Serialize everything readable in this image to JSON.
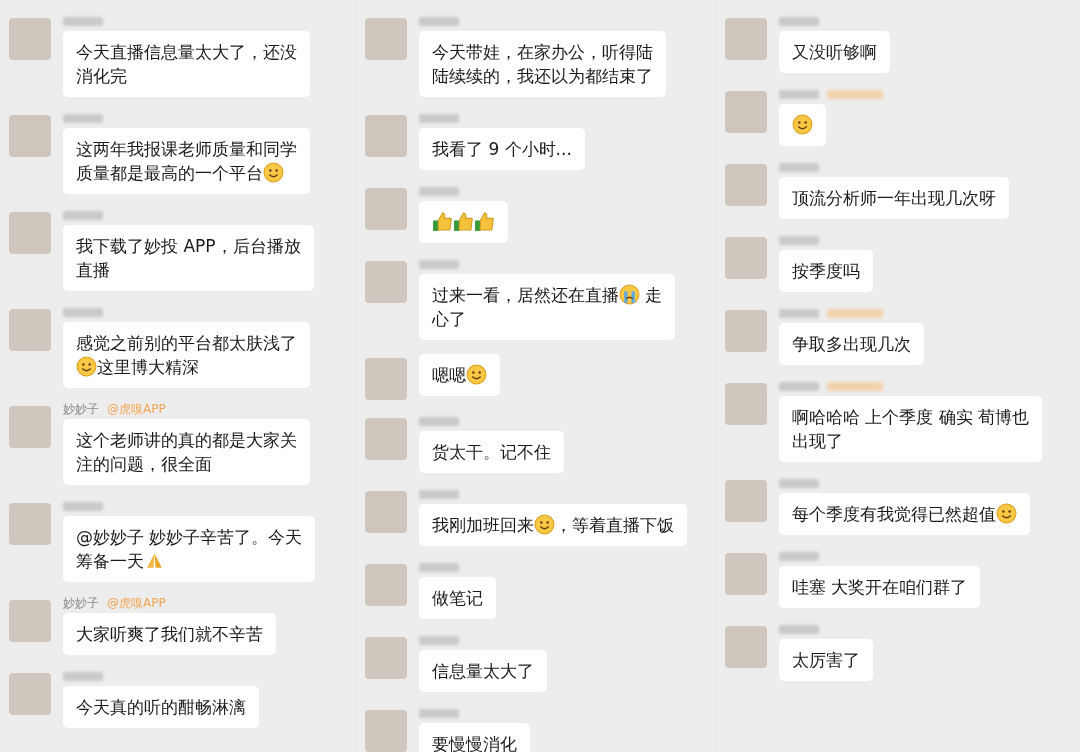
{
  "columns": [
    {
      "messages": [
        {
          "sender": {
            "kind": "blurred",
            "blurred_tag": false
          },
          "parts": [
            {
              "kind": "text",
              "text": "今天直播信息量太大了，还没"
            },
            {
              "kind": "break"
            },
            {
              "kind": "text",
              "text": "消化完"
            }
          ]
        },
        {
          "sender": {
            "kind": "blurred",
            "blurred_tag": false
          },
          "parts": [
            {
              "kind": "text",
              "text": "这两年我报课老师质量和同学"
            },
            {
              "kind": "break"
            },
            {
              "kind": "text",
              "text": "质量都是最高的一个平台"
            },
            {
              "kind": "smile"
            }
          ]
        },
        {
          "sender": {
            "kind": "blurred",
            "blurred_tag": false
          },
          "parts": [
            {
              "kind": "text",
              "text": "我下载了妙投 APP，后台播放"
            },
            {
              "kind": "break"
            },
            {
              "kind": "text",
              "text": "直播"
            }
          ]
        },
        {
          "sender": {
            "kind": "blurred",
            "blurred_tag": false
          },
          "parts": [
            {
              "kind": "text",
              "text": "感觉之前别的平台都太肤浅了"
            },
            {
              "kind": "break"
            },
            {
              "kind": "smile"
            },
            {
              "kind": "text",
              "text": "这里博大精深"
            }
          ]
        },
        {
          "sender": {
            "kind": "named",
            "name": "妙妙子",
            "tag": "@虎嗅APP"
          },
          "parts": [
            {
              "kind": "text",
              "text": "这个老师讲的真的都是大家关"
            },
            {
              "kind": "break"
            },
            {
              "kind": "text",
              "text": "注的问题，很全面"
            }
          ]
        },
        {
          "sender": {
            "kind": "blurred",
            "blurred_tag": false
          },
          "parts": [
            {
              "kind": "text",
              "text": "@妙妙子 妙妙子辛苦了。今天"
            },
            {
              "kind": "break"
            },
            {
              "kind": "text",
              "text": "筹备一天"
            },
            {
              "kind": "hands"
            }
          ]
        },
        {
          "sender": {
            "kind": "named",
            "name": "妙妙子",
            "tag": "@虎嗅APP"
          },
          "parts": [
            {
              "kind": "text",
              "text": "大家听爽了我们就不辛苦"
            }
          ]
        },
        {
          "sender": {
            "kind": "blurred",
            "blurred_tag": false
          },
          "parts": [
            {
              "kind": "text",
              "text": "今天真的听的酣畅淋漓"
            }
          ]
        }
      ]
    },
    {
      "messages": [
        {
          "sender": {
            "kind": "blurred",
            "blurred_tag": false
          },
          "parts": [
            {
              "kind": "text",
              "text": "今天带娃，在家办公，听得陆"
            },
            {
              "kind": "break"
            },
            {
              "kind": "text",
              "text": "陆续续的，我还以为都结束了"
            }
          ]
        },
        {
          "sender": {
            "kind": "blurred",
            "blurred_tag": false
          },
          "parts": [
            {
              "kind": "text",
              "text": "我看了 9 个小时..."
            }
          ]
        },
        {
          "sender": {
            "kind": "blurred",
            "blurred_tag": false
          },
          "parts": [
            {
              "kind": "thumbs"
            },
            {
              "kind": "thumbs"
            },
            {
              "kind": "thumbs"
            }
          ]
        },
        {
          "sender": {
            "kind": "blurred",
            "blurred_tag": false
          },
          "parts": [
            {
              "kind": "text",
              "text": "过来一看，居然还在直播"
            },
            {
              "kind": "cry"
            },
            {
              "kind": "text",
              "text": " 走"
            },
            {
              "kind": "break"
            },
            {
              "kind": "text",
              "text": "心了"
            }
          ]
        },
        {
          "sender": {
            "kind": "none"
          },
          "parts": [
            {
              "kind": "text",
              "text": "嗯嗯"
            },
            {
              "kind": "smile"
            }
          ]
        },
        {
          "sender": {
            "kind": "blurred",
            "blurred_tag": false
          },
          "parts": [
            {
              "kind": "text",
              "text": "货太干。记不住"
            }
          ]
        },
        {
          "sender": {
            "kind": "blurred",
            "blurred_tag": false
          },
          "parts": [
            {
              "kind": "text",
              "text": "我刚加班回来"
            },
            {
              "kind": "smile"
            },
            {
              "kind": "text",
              "text": "，等着直播下饭"
            }
          ]
        },
        {
          "sender": {
            "kind": "blurred",
            "blurred_tag": false
          },
          "parts": [
            {
              "kind": "text",
              "text": "做笔记"
            }
          ]
        },
        {
          "sender": {
            "kind": "blurred",
            "blurred_tag": false
          },
          "parts": [
            {
              "kind": "text",
              "text": "信息量太大了"
            }
          ]
        },
        {
          "sender": {
            "kind": "blurred",
            "blurred_tag": false
          },
          "parts": [
            {
              "kind": "text",
              "text": "要慢慢消化"
            }
          ]
        }
      ]
    },
    {
      "messages": [
        {
          "sender": {
            "kind": "blurred",
            "blurred_tag": false
          },
          "parts": [
            {
              "kind": "text",
              "text": "又没听够啊"
            }
          ]
        },
        {
          "sender": {
            "kind": "blurred",
            "blurred_tag": true
          },
          "parts": [
            {
              "kind": "smile"
            }
          ]
        },
        {
          "sender": {
            "kind": "blurred",
            "blurred_tag": false
          },
          "parts": [
            {
              "kind": "text",
              "text": "顶流分析师一年出现几次呀"
            }
          ]
        },
        {
          "sender": {
            "kind": "blurred",
            "blurred_tag": false
          },
          "parts": [
            {
              "kind": "text",
              "text": "按季度吗"
            }
          ]
        },
        {
          "sender": {
            "kind": "blurred",
            "blurred_tag": true
          },
          "parts": [
            {
              "kind": "text",
              "text": "争取多出现几次"
            }
          ]
        },
        {
          "sender": {
            "kind": "blurred",
            "blurred_tag": true
          },
          "parts": [
            {
              "kind": "text",
              "text": "啊哈哈哈 上个季度 确实 荀博也"
            },
            {
              "kind": "break"
            },
            {
              "kind": "text",
              "text": "出现了"
            }
          ]
        },
        {
          "sender": {
            "kind": "blurred",
            "blurred_tag": false
          },
          "parts": [
            {
              "kind": "text",
              "text": "每个季度有我觉得已然超值"
            },
            {
              "kind": "smile"
            }
          ]
        },
        {
          "sender": {
            "kind": "blurred",
            "blurred_tag": false
          },
          "parts": [
            {
              "kind": "text",
              "text": "哇塞 大奖开在咱们群了"
            }
          ]
        },
        {
          "sender": {
            "kind": "blurred",
            "blurred_tag": false
          },
          "parts": [
            {
              "kind": "text",
              "text": "太厉害了"
            }
          ]
        }
      ]
    }
  ]
}
